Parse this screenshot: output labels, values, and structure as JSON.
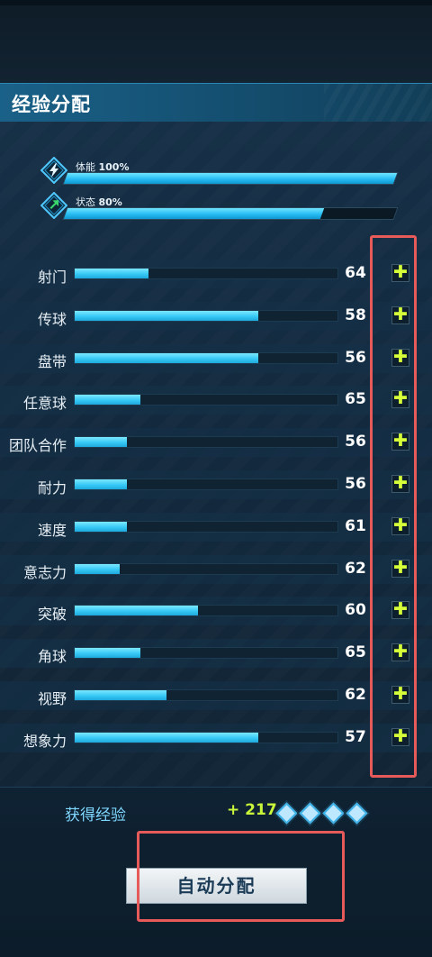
{
  "title": "经验分配",
  "status": [
    {
      "name": "体能",
      "value": "100%",
      "level": 1.0,
      "icon": "lightning-icon"
    },
    {
      "name": "状态",
      "value": "80%",
      "level": 0.78,
      "icon": "arrow-up-icon"
    }
  ],
  "attributes": [
    {
      "label": "射门",
      "value": "64",
      "level": 0.28
    },
    {
      "label": "传球",
      "value": "58",
      "level": 0.7
    },
    {
      "label": "盘带",
      "value": "56",
      "level": 0.7
    },
    {
      "label": "任意球",
      "value": "65",
      "level": 0.25
    },
    {
      "label": "团队合作",
      "value": "56",
      "level": 0.2
    },
    {
      "label": "耐力",
      "value": "56",
      "level": 0.2
    },
    {
      "label": "速度",
      "value": "61",
      "level": 0.2
    },
    {
      "label": "意志力",
      "value": "62",
      "level": 0.17
    },
    {
      "label": "突破",
      "value": "60",
      "level": 0.47
    },
    {
      "label": "角球",
      "value": "65",
      "level": 0.25
    },
    {
      "label": "视野",
      "value": "62",
      "level": 0.35
    },
    {
      "label": "想象力",
      "value": "57",
      "level": 0.7
    }
  ],
  "plus_label": "✚",
  "experience": {
    "label": "获得经验",
    "value": "+ 217",
    "diamonds": 4
  },
  "auto_button": "自动分配",
  "colors": {
    "accent": "#37c9f5",
    "plus": "#d6ff3a",
    "exp": "#c9f53a",
    "highlight": "#e65a5a"
  }
}
